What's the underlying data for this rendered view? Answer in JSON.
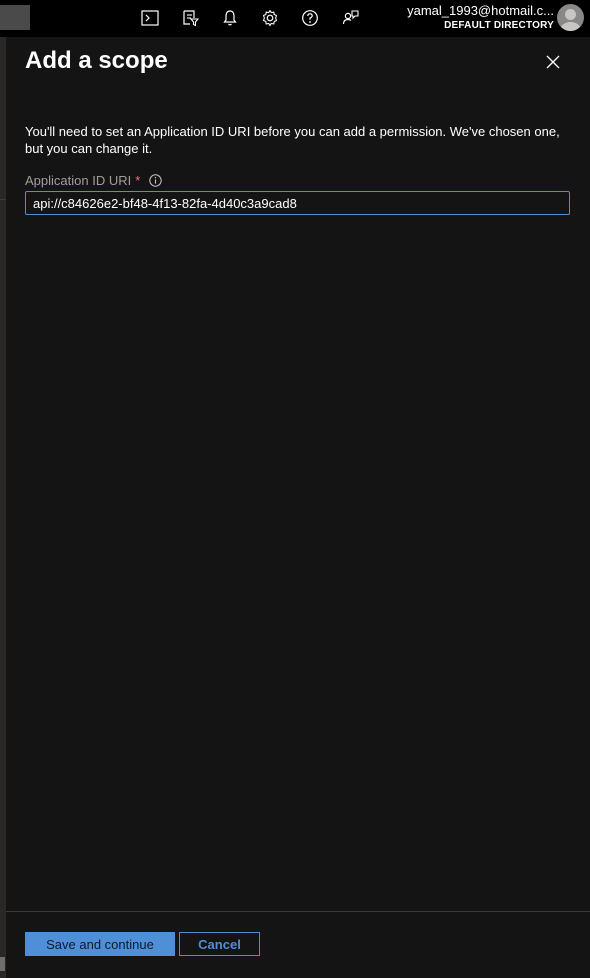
{
  "topbar": {
    "icons": [
      "cloud-shell-icon",
      "directory-filter-icon",
      "notifications-icon",
      "settings-icon",
      "help-icon",
      "feedback-icon"
    ],
    "account_email": "yamal_1993@hotmail.c...",
    "account_directory": "DEFAULT DIRECTORY"
  },
  "panel": {
    "title": "Add a scope",
    "intro": "You'll need to set an Application ID URI before you can add a permission. We've chosen one, but you can change it.",
    "field_label": "Application ID URI",
    "required_mark": "*",
    "uri_value": "api://c84626e2-bf48-4f13-82fa-4d40c3a9cad8"
  },
  "footer": {
    "save_label": "Save and continue",
    "cancel_label": "Cancel"
  },
  "colors": {
    "accent": "#4f8fd8",
    "panel_bg": "#141414",
    "topbar_bg": "#000000",
    "required": "#f1707b"
  }
}
